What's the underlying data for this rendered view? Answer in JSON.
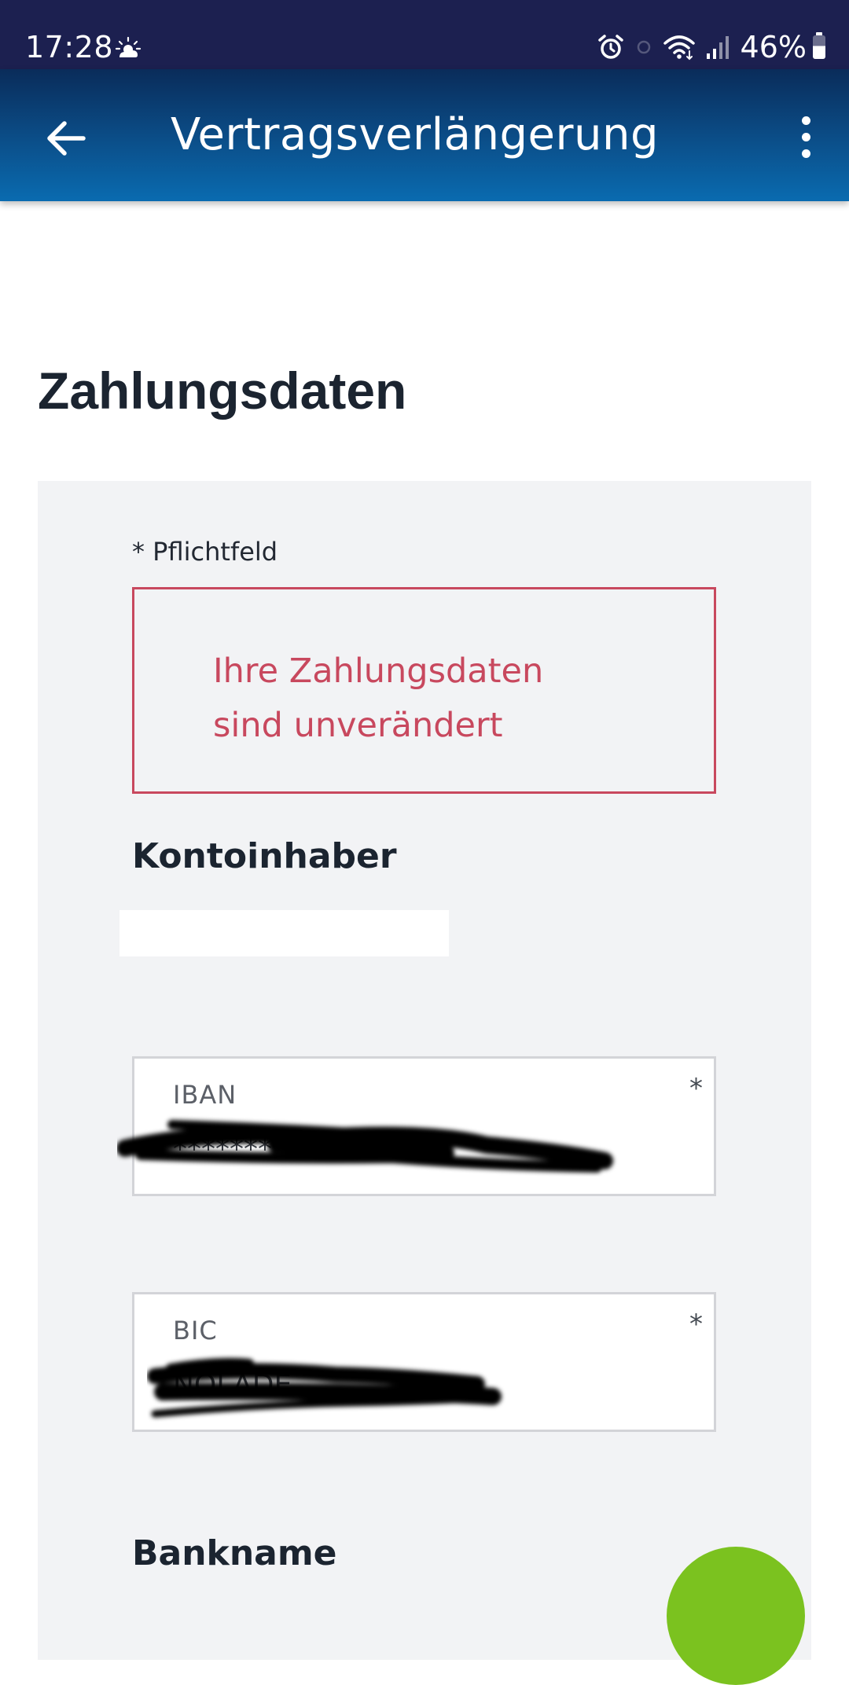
{
  "status_bar": {
    "time": "17:28",
    "battery_percent": "46%",
    "icons": [
      "weather-sun-cloud-icon",
      "alarm-icon",
      "wifi-icon",
      "signal-icon",
      "battery-icon"
    ]
  },
  "app_bar": {
    "title": "Vertragsverlängerung",
    "back_icon": "arrow-left-icon",
    "menu_icon": "more-vert-icon"
  },
  "page": {
    "heading": "Zahlungsdaten"
  },
  "form": {
    "required_note": "* Pflichtfeld",
    "info_message_line1": "Ihre Zahlungsdaten",
    "info_message_line2": "sind unverändert",
    "account_holder_label": "Kontoinhaber",
    "iban": {
      "label": "IBAN",
      "required_marker": "*",
      "value": "**********"
    },
    "bic": {
      "label": "BIC",
      "required_marker": "*",
      "value": "NOLADE"
    },
    "bank_name_label": "Bankname"
  },
  "colors": {
    "status_bar": "#1c2050",
    "app_bar_top": "#0a2c5a",
    "app_bar_bottom": "#0a6bb0",
    "info_accent": "#c8485e",
    "card_background": "#f2f3f5",
    "fab": "#7bc21f",
    "heading_text": "#1b2430"
  }
}
